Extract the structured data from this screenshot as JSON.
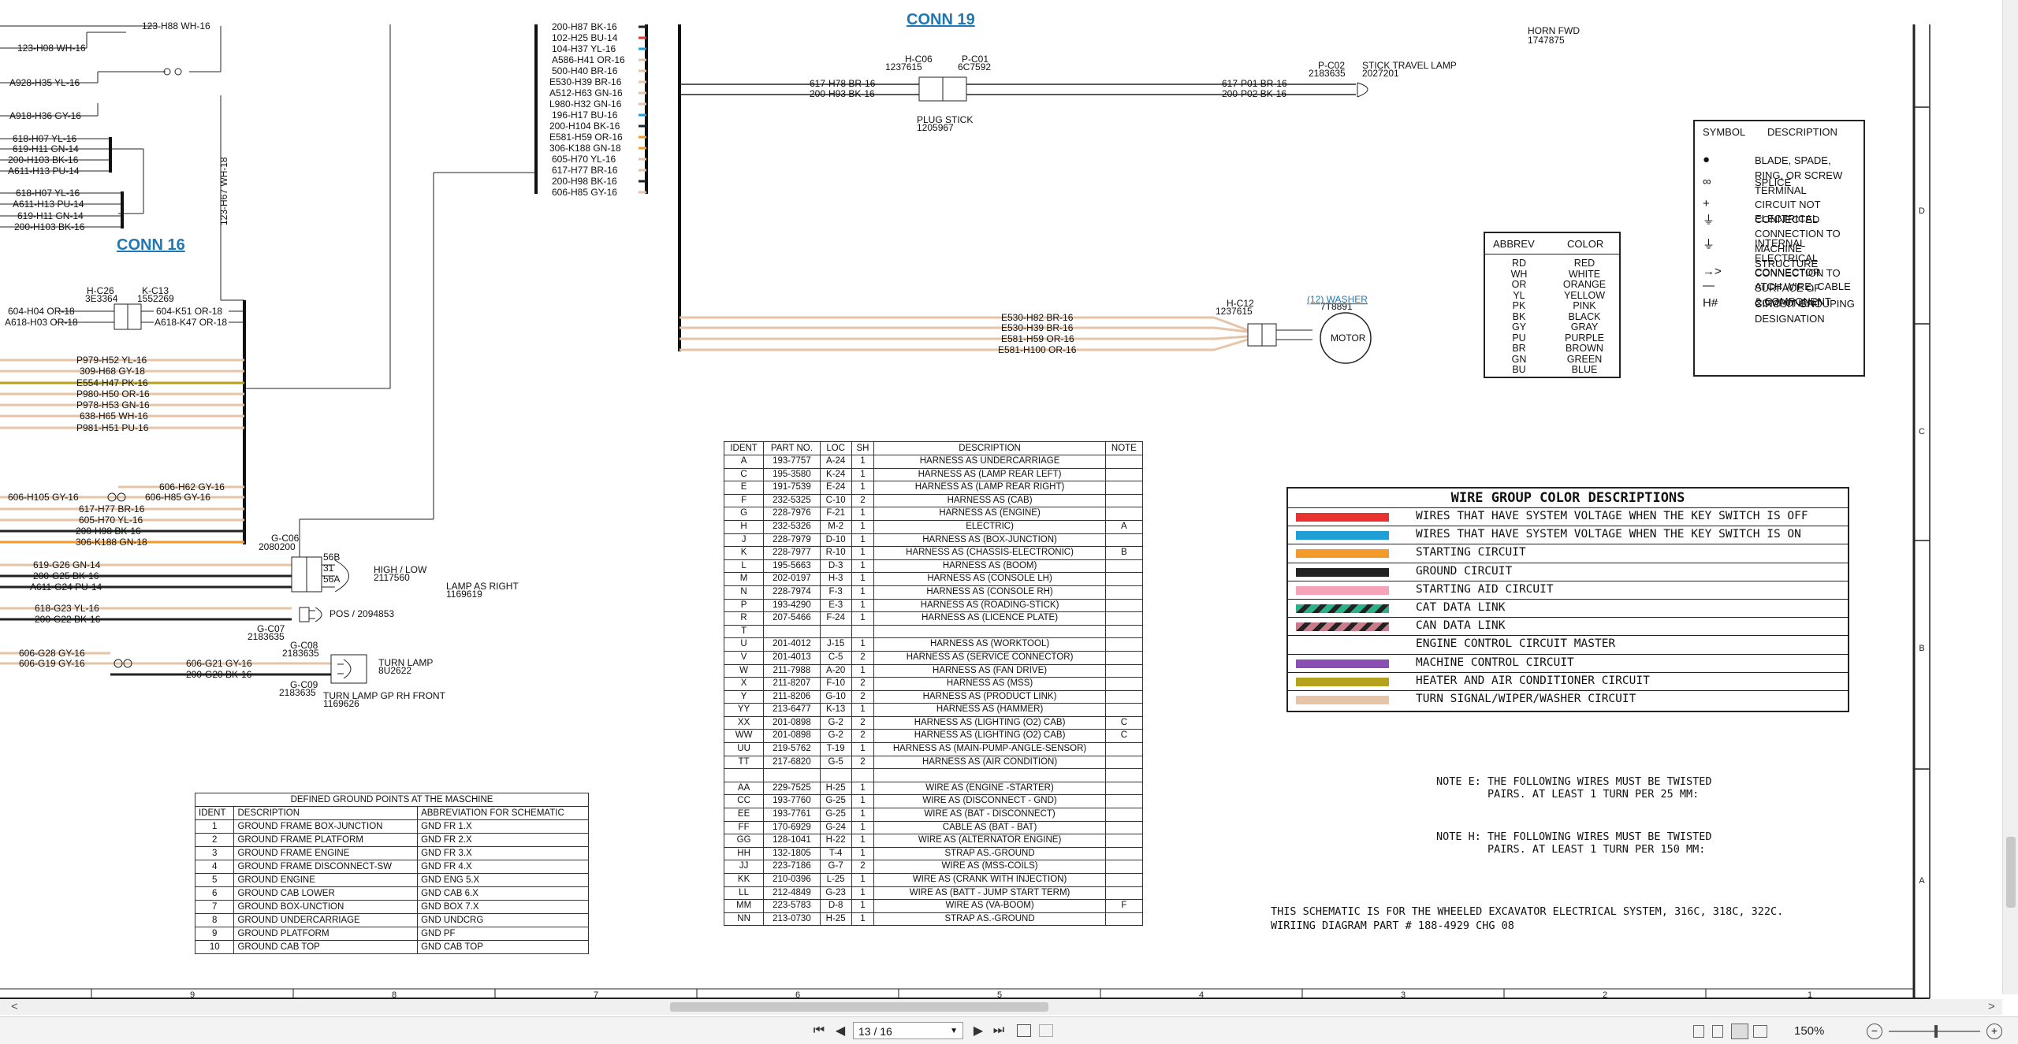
{
  "connectors": {
    "conn19": {
      "title": "CONN 19",
      "left_id": "H-C06",
      "left_part": "1237615",
      "right_id": "P-C01",
      "right_part": "6C7592"
    },
    "conn16": {
      "title": "CONN 16",
      "left_id": "H-C26",
      "left_part": "3E3364",
      "right_id": "K-C13",
      "right_part": "1552269"
    }
  },
  "top_left_labels": [
    "123-H08 WH-16",
    "A928-H35 YL-16",
    "A918-H36 GY-16",
    "618-H07 YL-16",
    "619-H11 GN-14",
    "200-H103 BK-16",
    "A611-H13 PU-14",
    "618-H07 YL-16",
    "A611-H13 PU-14",
    "619-H11 GN-14",
    "200-H103 BK-16",
    "123-H88 WH-16"
  ],
  "vertical_label": "123-H67 WH-18",
  "mid_column_labels": [
    "200-H87 BK-16",
    "102-H25 BU-14",
    "104-H37 YL-16",
    "A586-H41 OR-16",
    "500-H40 BR-16",
    "E530-H39 BR-16",
    "A512-H63 GN-16",
    "L980-H32 GN-16",
    "196-H17 BU-16",
    "200-H104 BK-16",
    "E581-H59 OR-16",
    "306-K188 GN-18",
    "605-H70 YL-16",
    "617-H77 BR-16",
    "200-H98 BK-16",
    "606-H85 GY-16"
  ],
  "conn19_wires": {
    "left": [
      "617-H78 BR-16",
      "200-H93 BK-16"
    ],
    "right": [
      "617-P01 BR-16",
      "200-P02 BK-16"
    ],
    "plug": "PLUG STICK",
    "plug_part": "1205967",
    "pc02": "P-C02",
    "pc02_part": "2183635",
    "lamp": "STICK TRAVEL LAMP",
    "lamp_part": "2027201"
  },
  "horn": {
    "label": "HORN FWD",
    "part": "1747875"
  },
  "conn16_wires": {
    "left": [
      "604-H04 OR-18",
      "A618-H03 OR-18"
    ],
    "right": [
      "604-K51 OR-18",
      "A618-K47 OR-18"
    ]
  },
  "left_wire_labels": [
    "P979-H52 YL-16",
    "309-H68 GY-18",
    "E554-H47 PK-16",
    "P980-H50 OR-16",
    "P978-H53 GN-16",
    "638-H65 WH-16",
    "P981-H51 PU-16"
  ],
  "lower_left_labels": [
    "606-H62 GY-16",
    "606-H105 GY-16",
    "606-H85 GY-16",
    "617-H77 BR-16",
    "605-H70 YL-16",
    "200-H98 BK-16",
    "306-K188 GN-18"
  ],
  "lamp_right": {
    "gc06": "G-C06",
    "gc06_part": "2080200",
    "pins": [
      "56B",
      "31",
      "56A"
    ],
    "high_low": "HIGH / LOW",
    "high_low_part": "2117560",
    "lamp": "LAMP AS RIGHT",
    "lamp_part": "1169619",
    "pos": "POS / 2094853",
    "gc07": "G-C07",
    "gc07_part": "2183635",
    "wires": [
      "619-G26 GN-14",
      "200-G25 BK-16",
      "A611-G24 PU-14",
      "618-G23 YL-16",
      "200-G22 BK-16"
    ]
  },
  "turn_lamp": {
    "gc08": "G-C08",
    "gc08_part": "2183635",
    "gc09": "G-C09",
    "gc09_part": "2183635",
    "label": "TURN LAMP",
    "part": "8U2622",
    "gp": "TURN LAMP GP RH FRONT",
    "gp_part": "1169626",
    "wires": [
      "606-G28 GY-16",
      "606-G19 GY-16",
      "606-G21 GY-16",
      "200-G20 BK-16"
    ]
  },
  "washer": {
    "hc12": "H-C12",
    "hc12_part": "1237615",
    "link": "(12) WASHER",
    "part": "7T8891",
    "motor": "MOTOR",
    "wires": [
      "E530-H82 BR-16",
      "E530-H39 BR-16",
      "E581-H59 OR-16",
      "E581-H100 OR-16"
    ]
  },
  "symbol_table": {
    "headers": [
      "SYMBOL",
      "DESCRIPTION"
    ],
    "rows": [
      {
        "sym": "●",
        "desc": "BLADE, SPADE, RING, OR SCREW TERMINAL"
      },
      {
        "sym": "∞",
        "desc": "SPLICE"
      },
      {
        "sym": "+",
        "desc": "CIRCUIT NOT CONNECTED"
      },
      {
        "sym": "⏚",
        "desc": "ELECTRICAL CONNECTION TO MACHINE STRUCTURE"
      },
      {
        "sym": "⏚",
        "desc": "INTERNAL ELECTRICAL CONNECTION TO SURFACE OF COMPONENT"
      },
      {
        "sym": "→>",
        "desc": "CONNECTOR"
      },
      {
        "sym": "—",
        "desc": "ATCH WIRE, CABLE   &   COMPONENT"
      },
      {
        "sym": "H#",
        "desc": "CIRCUIT GROUPING DESIGNATION"
      }
    ]
  },
  "abbrev_table": {
    "headers": [
      "ABBREV",
      "COLOR"
    ],
    "rows": [
      [
        "RD",
        "RED"
      ],
      [
        "WH",
        "WHITE"
      ],
      [
        "OR",
        "ORANGE"
      ],
      [
        "YL",
        "YELLOW"
      ],
      [
        "PK",
        "PINK"
      ],
      [
        "BK",
        "BLACK"
      ],
      [
        "GY",
        "GRAY"
      ],
      [
        "PU",
        "PURPLE"
      ],
      [
        "BR",
        "BROWN"
      ],
      [
        "GN",
        "GREEN"
      ],
      [
        "BU",
        "BLUE"
      ]
    ]
  },
  "wire_groups": {
    "title": "WIRE GROUP COLOR DESCRIPTIONS",
    "rows": [
      {
        "color": "#e8322f",
        "text": "WIRES THAT HAVE SYSTEM VOLTAGE WHEN THE KEY SWITCH IS OFF"
      },
      {
        "color": "#1f9fd6",
        "text": "WIRES THAT HAVE SYSTEM VOLTAGE WHEN THE KEY SWITCH IS ON"
      },
      {
        "color": "#f39a2b",
        "text": "STARTING CIRCUIT"
      },
      {
        "color": "#222222",
        "text": "GROUND CIRCUIT"
      },
      {
        "color": "#f4a3b8",
        "text": "STARTING AID CIRCUIT"
      },
      {
        "color": "#2fae8a",
        "text": "CAT DATA LINK"
      },
      {
        "color": "#c97b8a",
        "text": "CAN DATA LINK"
      },
      {
        "color": "#ffffff",
        "text": "ENGINE CONTROL CIRCUIT MASTER"
      },
      {
        "color": "#8a4fb5",
        "text": "MACHINE CONTROL CIRCUIT"
      },
      {
        "color": "#b5a21d",
        "text": "HEATER AND AIR CONDITIONER CIRCUIT"
      },
      {
        "color": "#e5c4a8",
        "text": "TURN SIGNAL/WIPER/WASHER CIRCUIT"
      }
    ]
  },
  "notes": {
    "note_e": "NOTE E: THE FOLLOWING WIRES MUST BE TWISTED\n        PAIRS. AT LEAST 1 TURN PER 25 MM:",
    "note_h": "NOTE H: THE FOLLOWING WIRES MUST BE TWISTED\n        PAIRS. AT LEAST 1 TURN PER 150 MM:",
    "schematic": "THIS SCHEMATIC IS FOR THE WHEELED EXCAVATOR ELECTRICAL SYSTEM, 316C, 318C, 322C.\nWIRIING DIAGRAM PART # 188-4929 CHG 08"
  },
  "parts_table": {
    "headers": [
      "IDENT",
      "PART NO.",
      "LOC",
      "SH",
      "DESCRIPTION",
      "NOTE"
    ],
    "rows": [
      [
        "A",
        "193-7757",
        "A-24",
        "1",
        "HARNESS AS UNDERCARRIAGE",
        ""
      ],
      [
        "C",
        "195-3580",
        "K-24",
        "1",
        "HARNESS AS (LAMP REAR LEFT)",
        ""
      ],
      [
        "E",
        "191-7539",
        "E-24",
        "1",
        "HARNESS AS (LAMP REAR RIGHT)",
        ""
      ],
      [
        "F",
        "232-5325",
        "C-10",
        "2",
        "HARNESS AS (CAB)",
        ""
      ],
      [
        "G",
        "228-7976",
        "F-21",
        "1",
        "HARNESS AS (ENGINE)",
        ""
      ],
      [
        "H",
        "232-5326",
        "M-2",
        "1",
        "ELECTRIC)",
        "A"
      ],
      [
        "J",
        "228-7979",
        "D-10",
        "1",
        "HARNESS AS (BOX-JUNCTION)",
        ""
      ],
      [
        "K",
        "228-7977",
        "R-10",
        "1",
        "HARNESS AS (CHASSIS-ELECTRONIC)",
        "B"
      ],
      [
        "L",
        "195-5663",
        "D-3",
        "1",
        "HARNESS AS (BOOM)",
        ""
      ],
      [
        "M",
        "202-0197",
        "H-3",
        "1",
        "HARNESS AS (CONSOLE LH)",
        ""
      ],
      [
        "N",
        "228-7974",
        "F-3",
        "1",
        "HARNESS AS (CONSOLE RH)",
        ""
      ],
      [
        "P",
        "193-4290",
        "E-3",
        "1",
        "HARNESS AS (ROADING-STICK)",
        ""
      ],
      [
        "R",
        "207-5466",
        "F-24",
        "1",
        "HARNESS AS (LICENCE PLATE)",
        ""
      ],
      [
        "T",
        "",
        "",
        "",
        "",
        ""
      ],
      [
        "U",
        "201-4012",
        "J-15",
        "1",
        "HARNESS AS  (WORKTOOL)",
        ""
      ],
      [
        "V",
        "201-4013",
        "C-5",
        "2",
        "HARNESS AS  (SERVICE CONNECTOR)",
        ""
      ],
      [
        "W",
        "211-7988",
        "A-20",
        "1",
        "HARNESS AS (FAN DRIVE)",
        ""
      ],
      [
        "X",
        "211-8207",
        "F-10",
        "2",
        "HARNESS AS (MSS)",
        ""
      ],
      [
        "Y",
        "211-8206",
        "G-10",
        "2",
        "HARNESS AS (PRODUCT LINK)",
        ""
      ],
      [
        "YY",
        "213-6477",
        "K-13",
        "1",
        "HARNESS AS (HAMMER)",
        ""
      ],
      [
        "XX",
        "201-0898",
        "G-2",
        "2",
        "HARNESS AS (LIGHTING (O2) CAB)",
        "C"
      ],
      [
        "WW",
        "201-0898",
        "G-2",
        "2",
        "HARNESS AS (LIGHTING (O2) CAB)",
        "C"
      ],
      [
        "UU",
        "219-5762",
        "T-19",
        "1",
        "HARNESS AS (MAIN-PUMP-ANGLE-SENSOR)",
        ""
      ],
      [
        "TT",
        "217-6820",
        "G-5",
        "2",
        "HARNESS AS (AIR CONDITION)",
        ""
      ],
      [
        "",
        "",
        "",
        "",
        "",
        ""
      ],
      [
        "AA",
        "229-7525",
        "H-25",
        "1",
        "WIRE AS (ENGINE -STARTER)",
        ""
      ],
      [
        "CC",
        "193-7760",
        "G-25",
        "1",
        "WIRE AS (DISCONNECT - GND)",
        ""
      ],
      [
        "EE",
        "193-7761",
        "G-25",
        "1",
        "WIRE AS (BAT - DISCONNECT)",
        ""
      ],
      [
        "FF",
        "170-6929",
        "G-24",
        "1",
        "CABLE AS (BAT - BAT)",
        ""
      ],
      [
        "GG",
        "128-1041",
        "H-22",
        "1",
        "WIRE AS (ALTERNATOR ENGINE)",
        ""
      ],
      [
        "HH",
        "132-1805",
        "T-4",
        "1",
        "STRAP AS.-GROUND",
        ""
      ],
      [
        "JJ",
        "223-7186",
        "G-7",
        "2",
        "WIRE AS (MSS-COILS)",
        ""
      ],
      [
        "KK",
        "210-0396",
        "L-25",
        "1",
        "WIRE AS (CRANK WITH INJECTION)",
        ""
      ],
      [
        "LL",
        "212-4849",
        "G-23",
        "1",
        "WIRE AS (BATT - JUMP START TERM)",
        ""
      ],
      [
        "MM",
        "223-5783",
        "D-8",
        "1",
        "WIRE AS (VA-BOOM)",
        "F"
      ],
      [
        "NN",
        "213-0730",
        "H-25",
        "1",
        "STRAP AS.-GROUND",
        ""
      ]
    ]
  },
  "ground_table": {
    "title": "DEFINED GROUND POINTS AT THE MASCHINE",
    "headers": [
      "IDENT",
      "DESCRIPTION",
      "ABBREVIATION FOR SCHEMATIC"
    ],
    "rows": [
      [
        "1",
        "GROUND FRAME BOX-JUNCTION",
        "GND FR 1.X"
      ],
      [
        "2",
        "GROUND FRAME PLATFORM",
        "GND FR 2.X"
      ],
      [
        "3",
        "GROUND FRAME ENGINE",
        "GND FR 3.X"
      ],
      [
        "4",
        "GROUND FRAME DISCONNECT-SW",
        "GND FR 4.X"
      ],
      [
        "5",
        "GROUND ENGINE",
        "GND ENG 5.X"
      ],
      [
        "6",
        "GROUND CAB LOWER",
        "GND CAB 6.X"
      ],
      [
        "7",
        "GROUND BOX-UNCTION",
        "GND BOX 7.X"
      ],
      [
        "8",
        "GROUND UNDERCARRIAGE",
        "GND UNDCRG"
      ],
      [
        "9",
        "GROUND PLATFORM",
        "GND PF"
      ],
      [
        "10",
        "GROUND CAB TOP",
        "GND CAB TOP"
      ]
    ]
  },
  "ruler_numbers": [
    "9",
    "8",
    "7",
    "6",
    "5",
    "4",
    "3",
    "2",
    "1"
  ],
  "side_letters": [
    "D",
    "C",
    "B",
    "A"
  ],
  "toolbar": {
    "page_value": "13 / 16",
    "zoom": "150%",
    "first": "⏮",
    "prev": "◀",
    "next": "▶",
    "last": "⏭",
    "scroll_left": "<",
    "scroll_right": ">"
  }
}
